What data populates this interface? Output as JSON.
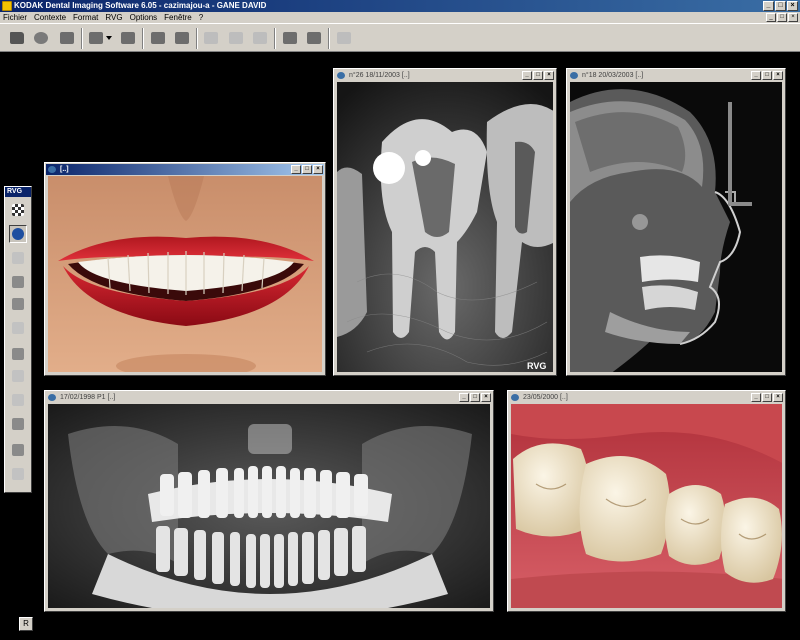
{
  "app": {
    "title": "KODAK Dental Imaging Software 6.05 - cazimajou-a - GANE DAVID"
  },
  "menu": {
    "items": [
      "Fichier",
      "Contexte",
      "Format",
      "RVG",
      "Options",
      "Fenêtre",
      "?"
    ]
  },
  "toolbar": {
    "icons": [
      "folder-open-icon",
      "cd-disk-icon",
      "camera-icon",
      "acquire-icon",
      "dropdown-arrow-icon",
      "network-icon",
      "home-icon",
      "print-icon",
      "image-view-icon",
      "bitewing-icon",
      "frame-icon",
      "rotate-icon",
      "display-icon",
      "export-icon"
    ]
  },
  "palette": {
    "title": "RVG",
    "tools": [
      "checker-icon",
      "rvg-sensor-icon",
      "pen-icon",
      "rotate-left-icon",
      "rotate-right-icon",
      "crop-icon",
      "eye-icon",
      "cube-icon",
      "tooth-icon",
      "hand-pointer-icon",
      "ruler-angle-icon",
      "star-icon"
    ]
  },
  "windows": {
    "smile": {
      "caption": "[..]"
    },
    "periapical": {
      "caption": "n°26 18/11/2003   [..]",
      "watermark": "RVG"
    },
    "ceph": {
      "caption": "n°18 20/03/2003   [..]"
    },
    "panoramic": {
      "caption": "17/02/1998 P1   [..]"
    },
    "molars": {
      "caption": "23/05/2000   [..]"
    }
  },
  "status": {
    "r_button": "R"
  },
  "colors": {
    "titlebar_start": "#0a246a",
    "titlebar_end": "#3a6ea5",
    "chrome": "#d4d0c8",
    "background": "#000000"
  }
}
